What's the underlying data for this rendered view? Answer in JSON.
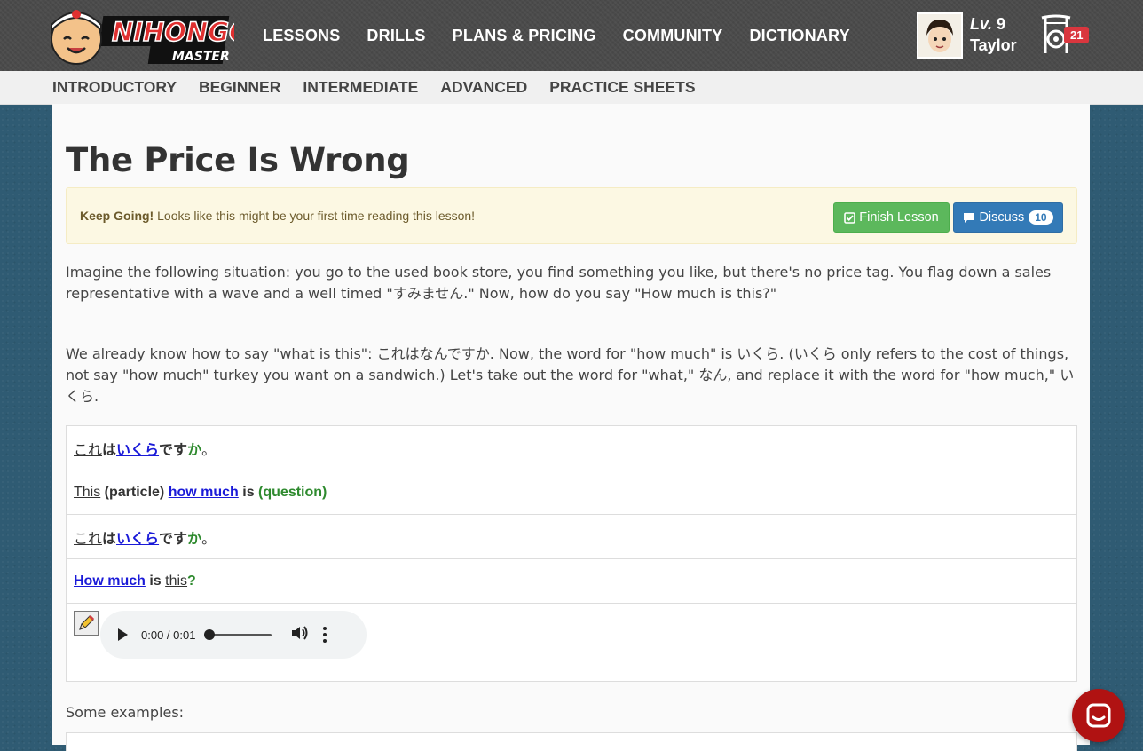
{
  "header": {
    "logo_alt": "NIHONGO MASTER",
    "nav": [
      "LESSONS",
      "DRILLS",
      "PLANS & PRICING",
      "COMMUNITY",
      "DICTIONARY"
    ],
    "user": {
      "level_prefix": "Lv.",
      "level": "9",
      "name": "Taylor"
    },
    "notifications": "21"
  },
  "subnav": [
    "INTRODUCTORY",
    "BEGINNER",
    "INTERMEDIATE",
    "ADVANCED",
    "PRACTICE SHEETS"
  ],
  "lesson": {
    "title": "The Price Is Wrong",
    "alert_bold": "Keep Going!",
    "alert_text": " Looks like this might be your first time reading this lesson!",
    "finish_label": "Finish Lesson",
    "discuss_label": "Discuss",
    "discuss_count": "10",
    "para1": "Imagine the following situation: you go to the used book store, you find something you like, but there's no price tag. You flag down a sales representative with a wave and a well timed \"すみません.\" Now, how do you say \"How much is this?\"",
    "para2": "We already know how to say \"what is this\": これはなんですか. Now, the word for \"how much\" is いくら. (いくら only refers to the cost of things, not say \"how much\" turkey you want on a sandwich.) Let's take out the word for \"what,\" なん, and replace it with the word for \"how much,\" いくら.",
    "row1": {
      "a": "これ",
      "b": "は",
      "c": "いくら",
      "d": "です",
      "e": "か",
      "f": "。"
    },
    "row2": {
      "a": "This",
      "b": " (particle) ",
      "c": "how much",
      "d": " is ",
      "e": "(question)"
    },
    "row3": {
      "a": "これ",
      "b": "は",
      "c": "いくら",
      "d": "です",
      "e": "か",
      "f": "。"
    },
    "row4": {
      "a": "How much",
      "b": " is ",
      "c": "this",
      "d": "?"
    },
    "audio_time": "0:00 / 0:01",
    "examples_label": "Some examples:"
  }
}
